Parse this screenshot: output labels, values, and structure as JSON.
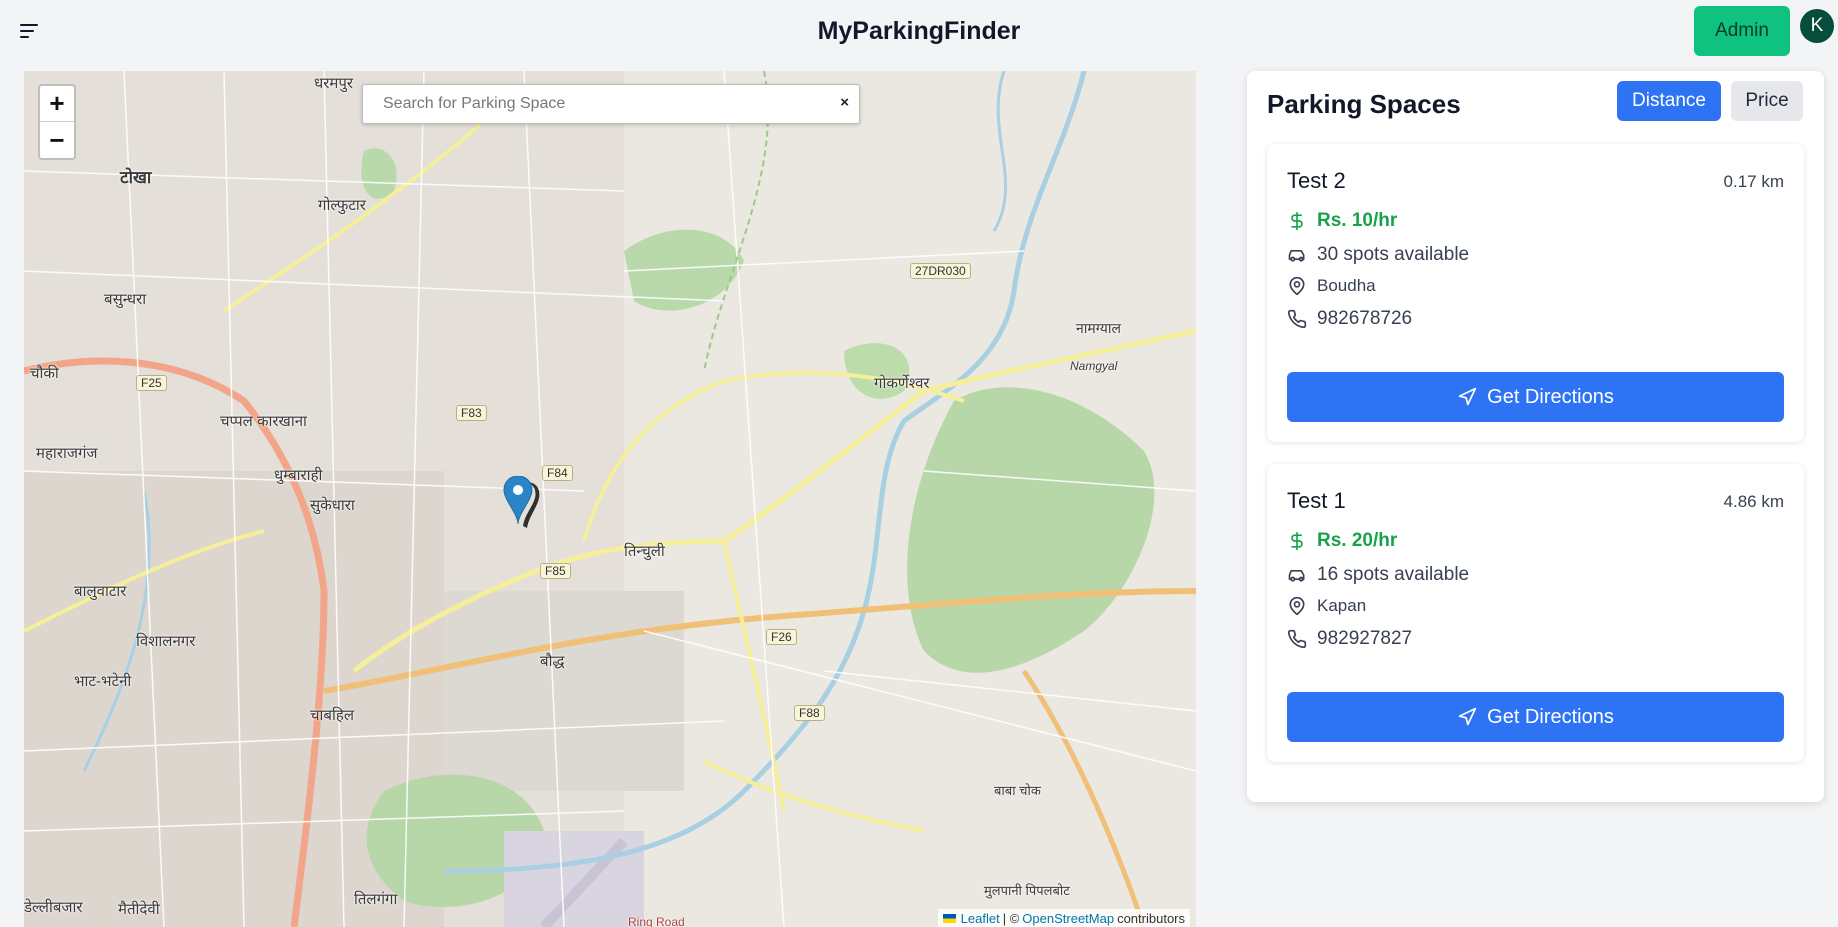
{
  "header": {
    "title": "MyParkingFinder",
    "admin_label": "Admin",
    "avatar_initial": "K"
  },
  "map": {
    "search_placeholder": "Search for Parking Space",
    "clear_symbol": "×",
    "zoom_in": "+",
    "zoom_out": "−",
    "attribution": {
      "leaflet": "Leaflet",
      "separator": "| ©",
      "osm": "OpenStreetMap",
      "suffix": "contributors"
    },
    "places": [
      {
        "name": "धरमपुर"
      },
      {
        "name": "टोखा"
      },
      {
        "name": "गोल्फुटार"
      },
      {
        "name": "बसुन्धरा"
      },
      {
        "name": "चौकी"
      },
      {
        "name": "चप्पल कारखाना"
      },
      {
        "name": "महाराजगंज"
      },
      {
        "name": "धुम्बाराही"
      },
      {
        "name": "सुकेधारा"
      },
      {
        "name": "बालुवाटार"
      },
      {
        "name": "विशालनगर"
      },
      {
        "name": "भाट-भटेनी"
      },
      {
        "name": "चाबहिल"
      },
      {
        "name": "तिन्चुली"
      },
      {
        "name": "बौद्ध"
      },
      {
        "name": "गोकर्णेश्वर"
      },
      {
        "name": "नामग्याल"
      },
      {
        "name": "Namgyal"
      },
      {
        "name": "बाबा चोक"
      },
      {
        "name": "मुलपानी पिपलबोट"
      },
      {
        "name": "डेल्लीबजार"
      },
      {
        "name": "मैतीदेवी"
      },
      {
        "name": "तिलगंगा"
      },
      {
        "name": "Ring Road"
      }
    ],
    "road_badges": [
      "F25",
      "F83",
      "F84",
      "F85",
      "F26",
      "F88",
      "27DR030"
    ]
  },
  "panel": {
    "title": "Parking Spaces",
    "sort_distance": "Distance",
    "sort_price": "Price",
    "cards": [
      {
        "name": "Test 2",
        "distance": "0.17 km",
        "price": "Rs. 10/hr",
        "spots": "30 spots available",
        "location": "Boudha",
        "phone": "982678726",
        "button": "Get Directions"
      },
      {
        "name": "Test 1",
        "distance": "4.86 km",
        "price": "Rs. 20/hr",
        "spots": "16 spots available",
        "location": "Kapan",
        "phone": "982927827",
        "button": "Get Directions"
      }
    ]
  },
  "colors": {
    "primary": "#2f73f5",
    "admin_green": "#10c27f",
    "price_green": "#16a34a",
    "avatar_bg": "#064e3b"
  }
}
